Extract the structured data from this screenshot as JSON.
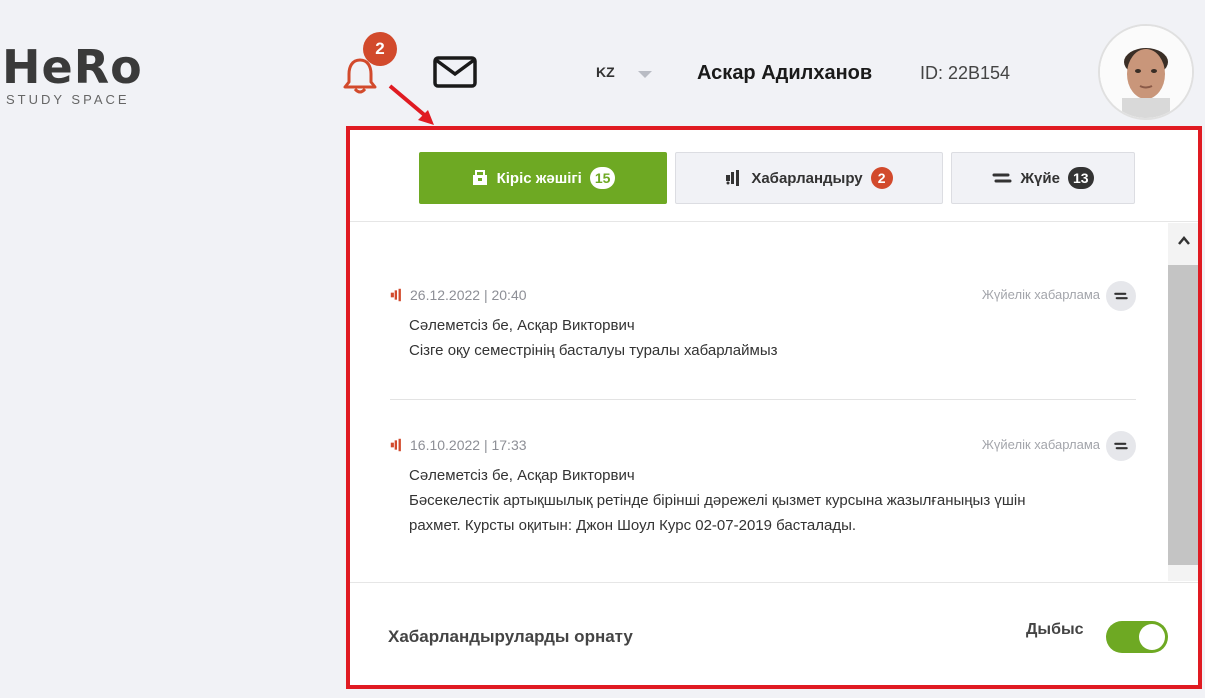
{
  "brand": {
    "logo": "HeRo",
    "tagline": "STUDY SPACE"
  },
  "header": {
    "bell_count": "2",
    "language": "KZ",
    "user_name": "Аскар Адилханов",
    "user_id": "ID: 22B154"
  },
  "tabs": [
    {
      "label": "Кіріс жәшігі",
      "count": "15",
      "icon": "inbox-icon"
    },
    {
      "label": "Хабарландыру",
      "count": "2",
      "icon": "megaphone-icon"
    },
    {
      "label": "Жүйе",
      "count": "13",
      "icon": "system-icon"
    }
  ],
  "messages": [
    {
      "date": "26.12.2022 | 20:40",
      "kind": "Жүйелік хабарлама",
      "greeting": "Сәлеметсіз бе, Асқар Викторвич",
      "text": "Сізге оқу семестрінің басталуы туралы хабарлаймыз"
    },
    {
      "date": "16.10.2022 | 17:33",
      "kind": "Жүйелік хабарлама",
      "greeting": "Сәлеметсіз бе, Асқар Викторвич",
      "text": "Бәсекелестік артықшылық ретінде бірінші дәрежелі қызмет курсына жазылғаныңыз үшін рахмет. Курсты оқитын: Джон Шоул Курс 02-07-2019 басталады."
    }
  ],
  "footer": {
    "settings_label": "Хабарландыруларды орнату",
    "sound_label": "Дыбыс",
    "sound_on": true
  },
  "colors": {
    "accent_green": "#6ea923",
    "badge_red": "#d24a2c",
    "highlight_red": "#e01b22"
  }
}
